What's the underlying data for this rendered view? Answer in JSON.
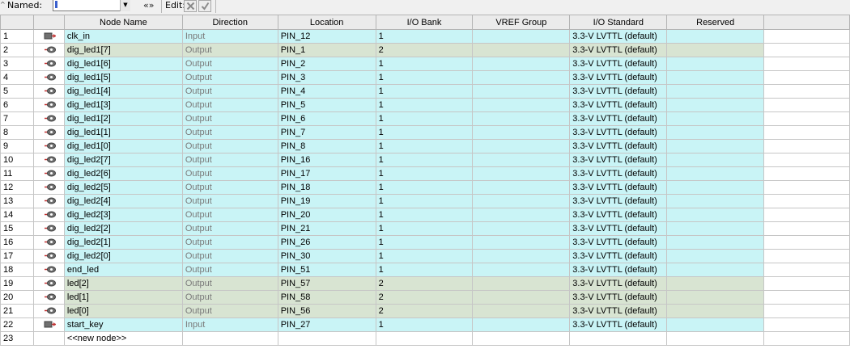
{
  "toolbar": {
    "named_label": "Named:",
    "named_value": "",
    "expand_label": "«»",
    "edit_label": "Edit:"
  },
  "columns": [
    "",
    "",
    "Node Name",
    "Direction",
    "Location",
    "I/O Bank",
    "VREF Group",
    "I/O Standard",
    "Reserved",
    ""
  ],
  "rows": [
    {
      "num": "1",
      "kind": "in",
      "name": "clk_in",
      "direction": "Input",
      "location": "PIN_12",
      "bank": "1",
      "vref": "",
      "standard": "3.3-V LVTTL (default)",
      "reserved": ""
    },
    {
      "num": "2",
      "kind": "out",
      "name": "dig_led1[7]",
      "direction": "Output",
      "location": "PIN_1",
      "bank": "2",
      "vref": "",
      "standard": "3.3-V LVTTL (default)",
      "reserved": ""
    },
    {
      "num": "3",
      "kind": "in",
      "name": "dig_led1[6]",
      "direction": "Output",
      "location": "PIN_2",
      "bank": "1",
      "vref": "",
      "standard": "3.3-V LVTTL (default)",
      "reserved": ""
    },
    {
      "num": "4",
      "kind": "in",
      "name": "dig_led1[5]",
      "direction": "Output",
      "location": "PIN_3",
      "bank": "1",
      "vref": "",
      "standard": "3.3-V LVTTL (default)",
      "reserved": ""
    },
    {
      "num": "5",
      "kind": "in",
      "name": "dig_led1[4]",
      "direction": "Output",
      "location": "PIN_4",
      "bank": "1",
      "vref": "",
      "standard": "3.3-V LVTTL (default)",
      "reserved": ""
    },
    {
      "num": "6",
      "kind": "in",
      "name": "dig_led1[3]",
      "direction": "Output",
      "location": "PIN_5",
      "bank": "1",
      "vref": "",
      "standard": "3.3-V LVTTL (default)",
      "reserved": ""
    },
    {
      "num": "7",
      "kind": "in",
      "name": "dig_led1[2]",
      "direction": "Output",
      "location": "PIN_6",
      "bank": "1",
      "vref": "",
      "standard": "3.3-V LVTTL (default)",
      "reserved": ""
    },
    {
      "num": "8",
      "kind": "in",
      "name": "dig_led1[1]",
      "direction": "Output",
      "location": "PIN_7",
      "bank": "1",
      "vref": "",
      "standard": "3.3-V LVTTL (default)",
      "reserved": ""
    },
    {
      "num": "9",
      "kind": "in",
      "name": "dig_led1[0]",
      "direction": "Output",
      "location": "PIN_8",
      "bank": "1",
      "vref": "",
      "standard": "3.3-V LVTTL (default)",
      "reserved": ""
    },
    {
      "num": "10",
      "kind": "in",
      "name": "dig_led2[7]",
      "direction": "Output",
      "location": "PIN_16",
      "bank": "1",
      "vref": "",
      "standard": "3.3-V LVTTL (default)",
      "reserved": ""
    },
    {
      "num": "11",
      "kind": "in",
      "name": "dig_led2[6]",
      "direction": "Output",
      "location": "PIN_17",
      "bank": "1",
      "vref": "",
      "standard": "3.3-V LVTTL (default)",
      "reserved": ""
    },
    {
      "num": "12",
      "kind": "in",
      "name": "dig_led2[5]",
      "direction": "Output",
      "location": "PIN_18",
      "bank": "1",
      "vref": "",
      "standard": "3.3-V LVTTL (default)",
      "reserved": ""
    },
    {
      "num": "13",
      "kind": "in",
      "name": "dig_led2[4]",
      "direction": "Output",
      "location": "PIN_19",
      "bank": "1",
      "vref": "",
      "standard": "3.3-V LVTTL (default)",
      "reserved": ""
    },
    {
      "num": "14",
      "kind": "in",
      "name": "dig_led2[3]",
      "direction": "Output",
      "location": "PIN_20",
      "bank": "1",
      "vref": "",
      "standard": "3.3-V LVTTL (default)",
      "reserved": ""
    },
    {
      "num": "15",
      "kind": "in",
      "name": "dig_led2[2]",
      "direction": "Output",
      "location": "PIN_21",
      "bank": "1",
      "vref": "",
      "standard": "3.3-V LVTTL (default)",
      "reserved": ""
    },
    {
      "num": "16",
      "kind": "in",
      "name": "dig_led2[1]",
      "direction": "Output",
      "location": "PIN_26",
      "bank": "1",
      "vref": "",
      "standard": "3.3-V LVTTL (default)",
      "reserved": ""
    },
    {
      "num": "17",
      "kind": "in",
      "name": "dig_led2[0]",
      "direction": "Output",
      "location": "PIN_30",
      "bank": "1",
      "vref": "",
      "standard": "3.3-V LVTTL (default)",
      "reserved": ""
    },
    {
      "num": "18",
      "kind": "in",
      "name": "end_led",
      "direction": "Output",
      "location": "PIN_51",
      "bank": "1",
      "vref": "",
      "standard": "3.3-V LVTTL (default)",
      "reserved": ""
    },
    {
      "num": "19",
      "kind": "out",
      "name": "led[2]",
      "direction": "Output",
      "location": "PIN_57",
      "bank": "2",
      "vref": "",
      "standard": "3.3-V LVTTL (default)",
      "reserved": ""
    },
    {
      "num": "20",
      "kind": "out",
      "name": "led[1]",
      "direction": "Output",
      "location": "PIN_58",
      "bank": "2",
      "vref": "",
      "standard": "3.3-V LVTTL (default)",
      "reserved": ""
    },
    {
      "num": "21",
      "kind": "out",
      "name": "led[0]",
      "direction": "Output",
      "location": "PIN_56",
      "bank": "2",
      "vref": "",
      "standard": "3.3-V LVTTL (default)",
      "reserved": ""
    },
    {
      "num": "22",
      "kind": "in",
      "name": "start_key",
      "direction": "Input",
      "location": "PIN_27",
      "bank": "1",
      "vref": "",
      "standard": "3.3-V LVTTL (default)",
      "reserved": ""
    }
  ],
  "new_node_row": {
    "num": "23",
    "label": "<<new node>>"
  },
  "icons": {
    "input_pin": "input-pin-icon",
    "output_pin": "output-pin-icon",
    "cancel": "x-icon",
    "accept": "checkmark-icon"
  },
  "colors": {
    "cyan_row": "#c9f4f6",
    "green_row": "#d8e4d2",
    "direction_text": "#7a7a7a"
  }
}
